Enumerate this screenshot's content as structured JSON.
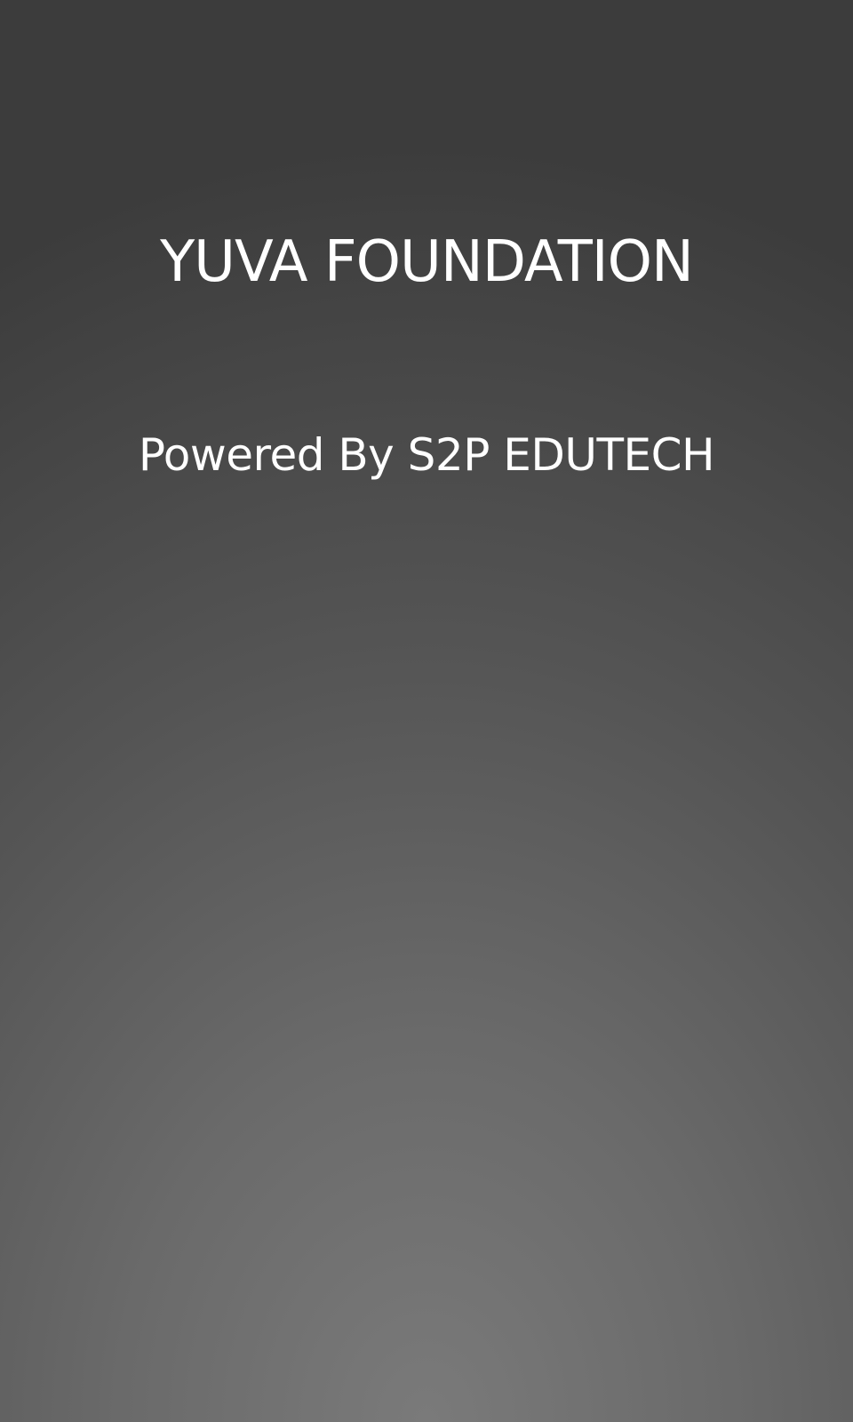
{
  "splash": {
    "title": "YUVA FOUNDATION",
    "powered_by": "Powered By S2P EDUTECH"
  },
  "colors": {
    "background_top": "#3c3c3c",
    "background_bottom": "#7a7a7a",
    "text": "#ffffff"
  }
}
